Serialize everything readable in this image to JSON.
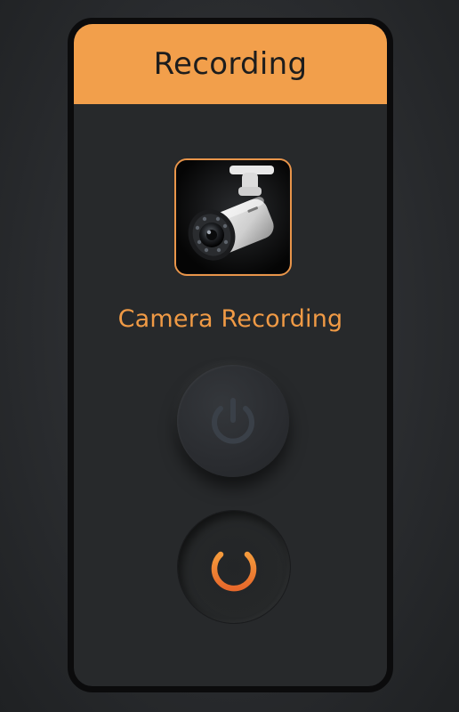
{
  "header": {
    "title": "Recording"
  },
  "camera": {
    "label": "Camera Recording",
    "icon": "cctv-camera-icon"
  },
  "controls": {
    "power_off_icon": "power-icon",
    "power_on_icon": "power-icon"
  },
  "colors": {
    "accent": "#f29f4b",
    "background": "#27292b",
    "power_inactive": "#3a4048",
    "power_active": "#f07a2a"
  }
}
